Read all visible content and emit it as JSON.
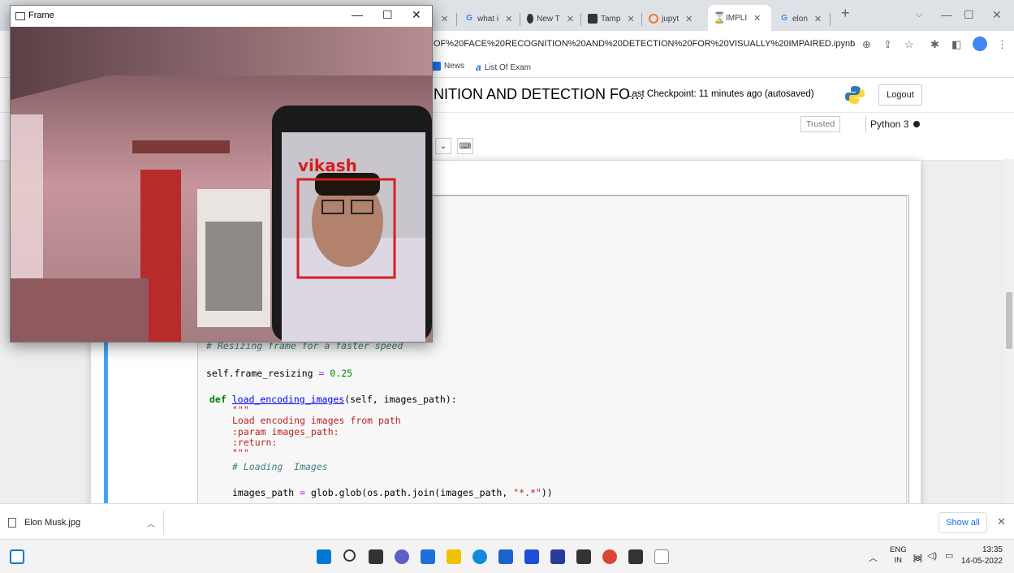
{
  "browser": {
    "tabs": [
      {
        "label": "",
        "icon": "sparkle-icon"
      },
      {
        "label": "what i",
        "icon": "google-icon"
      },
      {
        "label": "New T",
        "icon": "github-icon"
      },
      {
        "label": "Tamp",
        "icon": "tampermonkey-icon"
      },
      {
        "label": "jupyt",
        "icon": "jupyter-icon"
      },
      {
        "label": "IMPLI",
        "icon": "hourglass-icon"
      },
      {
        "label": "elon",
        "icon": "google-icon"
      }
    ],
    "url": "OF%20FACE%20RECOGNITION%20AND%20DETECTION%20FOR%20VISUALLY%20IMPAIRED.ipynb",
    "bookmarks": [
      {
        "label": "News"
      },
      {
        "label": "List Of Exam"
      }
    ]
  },
  "jupyter": {
    "title": "NITION AND DETECTION FO…",
    "checkpoint": "Last Checkpoint: 11 minutes ago  (autosaved)",
    "logout_label": "Logout",
    "trusted_label": "Trusted",
    "kernel_label": "Python 3"
  },
  "code": {
    "line1": "# Resizing frame for a faster speed",
    "line2a": "self.frame_resizing ",
    "line2b": "=",
    "line2c": " 0.25",
    "line3a": "def",
    "line3b": "load_encoding_images",
    "line3c": "(self, images_path):",
    "line4": "\"\"\"",
    "line5": "Load encoding images from path",
    "line6": ":param images_path:",
    "line7": ":return:",
    "line8": "\"\"\"",
    "line9": "# Loading  Images",
    "line10a": "images_path ",
    "line10b": "=",
    "line10c": " glob.glob(os.path.join(images_path, ",
    "line10d": "\"*.*\"",
    "line10e": "))"
  },
  "frame_window": {
    "title": "Frame",
    "detected_name": "vikash",
    "box_color": "#d51f1f"
  },
  "downloads": {
    "file_name": "Elon Musk.jpg",
    "show_all_label": "Show all"
  },
  "taskbar": {
    "lang_line1": "ENG",
    "lang_line2": "IN",
    "time": "13:35",
    "date": "14-05-2022"
  },
  "colors": {
    "accent": "#1a73e8",
    "cell_border": "#42a5f5"
  }
}
